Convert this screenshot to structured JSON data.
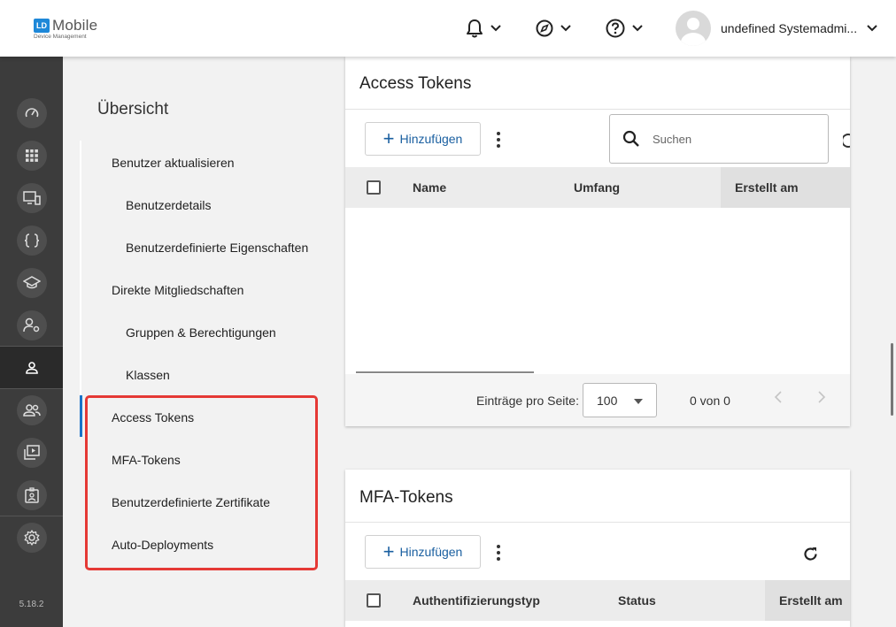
{
  "header": {
    "logo_badge": "LD",
    "logo_main": "Mobile",
    "logo_sub": "Device Management",
    "user_name": "undefined Systemadmi..."
  },
  "icons": {
    "notifications": "bell-icon",
    "explore": "compass-icon",
    "help": "help-icon",
    "settings": "gear-icon"
  },
  "rail": {
    "items": [
      {
        "name": "dashboard-icon"
      },
      {
        "name": "apps-grid-icon"
      },
      {
        "name": "devices-icon"
      },
      {
        "name": "scripts-icon"
      },
      {
        "name": "education-icon"
      },
      {
        "name": "admin-users-icon"
      },
      {
        "name": "user-icon",
        "active": true
      },
      {
        "name": "groups-icon"
      },
      {
        "name": "deployments-icon"
      },
      {
        "name": "badge-icon"
      }
    ],
    "version": "5.18.2"
  },
  "subnav": {
    "title": "Übersicht",
    "items": [
      {
        "label": "Benutzer aktualisieren"
      },
      {
        "label": "Benutzerdetails"
      },
      {
        "label": "Benutzerdefinierte Eigenschaften"
      },
      {
        "label": "Direkte Mitgliedschaften"
      },
      {
        "label": "Gruppen & Berechtigungen"
      },
      {
        "label": "Klassen"
      },
      {
        "label": "Access Tokens",
        "active": true
      },
      {
        "label": "MFA-Tokens"
      },
      {
        "label": "Benutzerdefinierte Zertifikate"
      },
      {
        "label": "Auto-Deployments"
      }
    ],
    "highlight_color": "#e53935",
    "active_color": "#1a73c8"
  },
  "access_tokens": {
    "title": "Access Tokens",
    "add_label": "Hinzufügen",
    "search_placeholder": "Suchen",
    "columns": [
      "Name",
      "Umfang",
      "Erstellt am"
    ],
    "rows": [],
    "footer": {
      "per_page_label": "Einträge pro Seite:",
      "per_page_value": "100",
      "range": "0 von 0"
    }
  },
  "mfa_tokens": {
    "title": "MFA-Tokens",
    "add_label": "Hinzufügen",
    "columns": [
      "Authentifizierungstyp",
      "Status",
      "Erstellt am"
    ]
  },
  "colors": {
    "accent": "#1a5fa0",
    "rail_bg": "#3c3c3c"
  }
}
